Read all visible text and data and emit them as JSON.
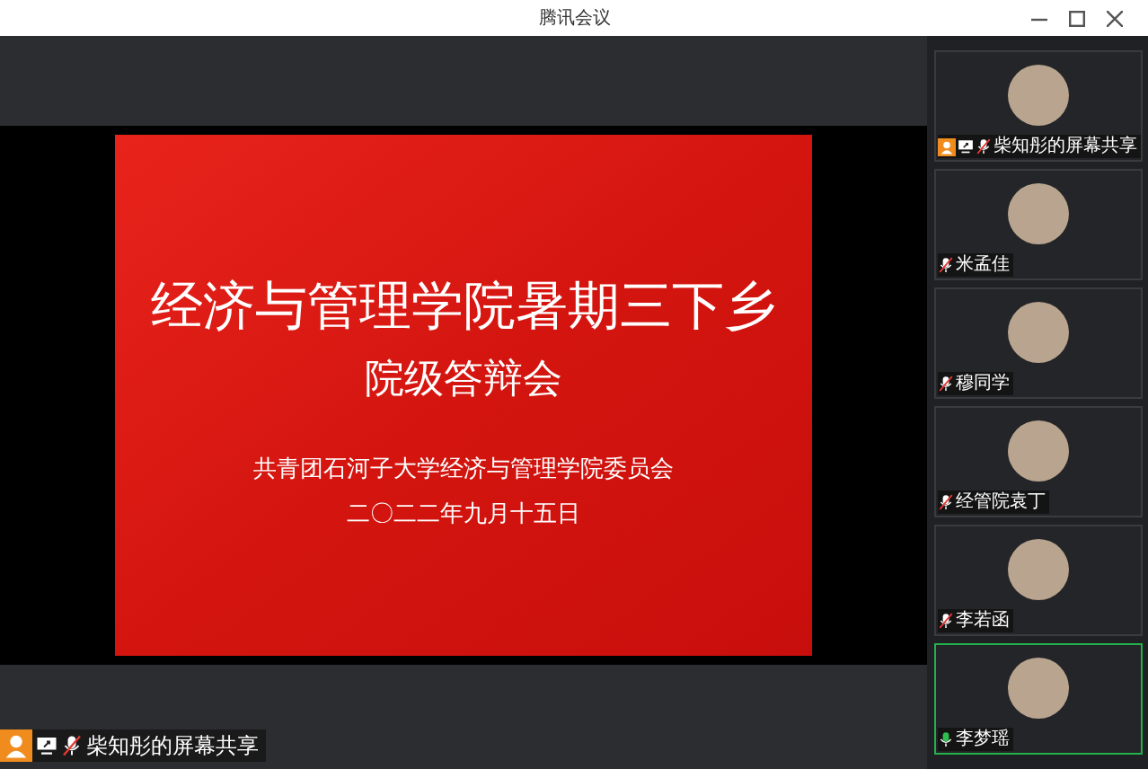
{
  "window": {
    "title": "腾讯会议"
  },
  "slide": {
    "title": "经济与管理学院暑期三下乡",
    "subtitle": "院级答辩会",
    "organization": "共青团石河子大学经济与管理学院委员会",
    "date": "二〇二二年九月十五日"
  },
  "presenter": {
    "name": "柴知彤的屏幕共享",
    "host": true,
    "sharing": true,
    "muted": true
  },
  "participants": [
    {
      "name": "柴知彤的屏幕共享",
      "host": true,
      "sharing": true,
      "muted": true,
      "speaking": false
    },
    {
      "name": "米孟佳",
      "host": false,
      "sharing": false,
      "muted": true,
      "speaking": false
    },
    {
      "name": "穆同学",
      "host": false,
      "sharing": false,
      "muted": true,
      "speaking": false
    },
    {
      "name": "经管院袁丁",
      "host": false,
      "sharing": false,
      "muted": true,
      "speaking": false
    },
    {
      "name": "李若函",
      "host": false,
      "sharing": false,
      "muted": true,
      "speaking": false
    },
    {
      "name": "李梦瑶",
      "host": false,
      "sharing": false,
      "muted": false,
      "speaking": true
    }
  ]
}
